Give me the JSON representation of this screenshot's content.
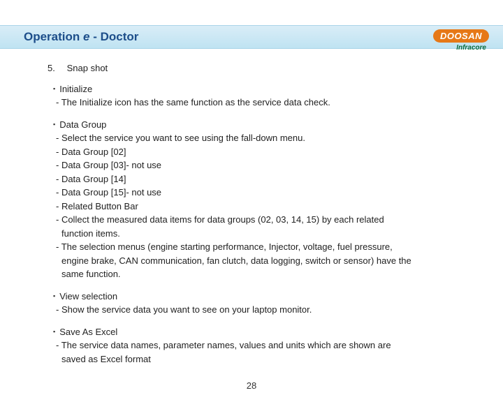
{
  "logo": {
    "main": "DOOSAN",
    "sub": "Infracore"
  },
  "title": {
    "prefix": "Operation ",
    "e": "e",
    "suffix": " - Doctor"
  },
  "section": {
    "num": "5.",
    "name": "Snap shot"
  },
  "blocks": {
    "init": {
      "head": "Initialize",
      "l1": "- The Initialize icon has the same function as the service data check."
    },
    "dg": {
      "head": "Data Group",
      "l1": "-  Select the service you want to see using the fall-down menu.",
      "l2": "-  Data Group [02]",
      "l3": "-  Data Group [03]- not use",
      "l4": "-  Data Group [14]",
      "l5": "-  Data Group [15]- not use",
      "l6": "-  Related Button Bar",
      "l7": "-  Collect the measured data items for data groups (02, 03, 14, 15) by each related",
      "l7b": "function items.",
      "l8": "-  The selection menus (engine starting performance, Injector, voltage, fuel pressure,",
      "l8b": "engine brake, CAN communication, fan clutch, data logging, switch or sensor) have the",
      "l8c": "same function."
    },
    "view": {
      "head": "View selection",
      "l1": "-  Show the service data you want to see on your laptop monitor."
    },
    "save": {
      "head": "Save As Excel",
      "l1": "-  The service data names, parameter names, values and units which are shown are",
      "l1b": "saved as Excel format"
    }
  },
  "page_num": "28"
}
